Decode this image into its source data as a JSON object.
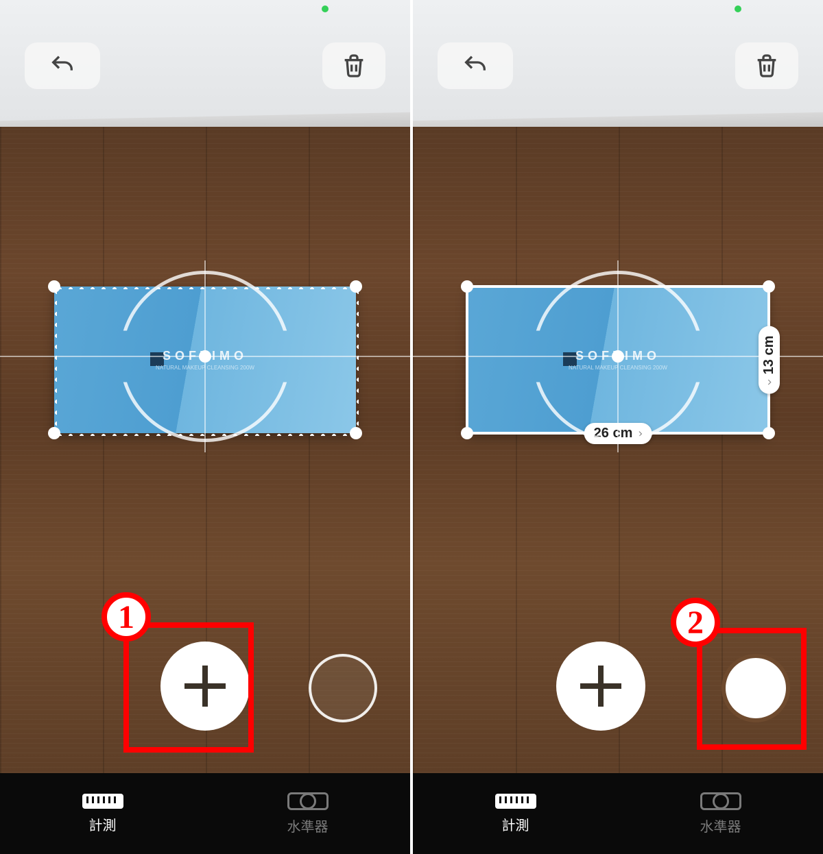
{
  "callouts": {
    "one": "1",
    "two": "2"
  },
  "box_brand": {
    "name": "SOFTIMO",
    "subtitle": "NATURAL MAKEUP CLEANSING 200W"
  },
  "left": {
    "tabs": {
      "measure": "計測",
      "level": "水準器"
    }
  },
  "right": {
    "tabs": {
      "measure": "計測",
      "level": "水準器"
    },
    "measurements": {
      "width": "26 cm",
      "height": "13 cm"
    }
  }
}
